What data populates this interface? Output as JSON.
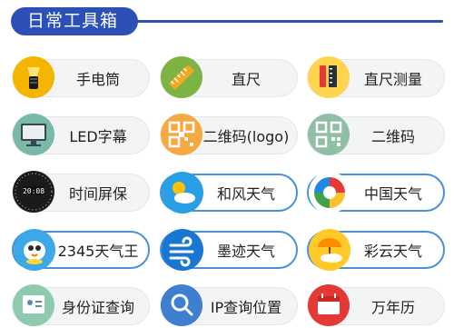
{
  "section": {
    "title": "日常工具箱",
    "accent": "#2c4fb8"
  },
  "tools": [
    {
      "label": "手电筒",
      "icon": "flashlight-icon"
    },
    {
      "label": "直尺",
      "icon": "ruler-icon"
    },
    {
      "label": "直尺测量",
      "icon": "ruler-measure-icon"
    },
    {
      "label": "LED字幕",
      "icon": "monitor-icon"
    },
    {
      "label": "二维码(logo)",
      "icon": "qr-logo-icon"
    },
    {
      "label": "二维码",
      "icon": "qr-code-icon"
    },
    {
      "label": "时间屏保",
      "icon": "digital-clock-icon"
    },
    {
      "label": "和风天气",
      "icon": "sun-cloud-icon"
    },
    {
      "label": "中国天气",
      "icon": "colorful-swirl-icon"
    },
    {
      "label": "2345天气王",
      "icon": "bird-mascot-icon"
    },
    {
      "label": "墨迹天气",
      "icon": "wind-icon"
    },
    {
      "label": "彩云天气",
      "icon": "umbrella-cloud-icon"
    },
    {
      "label": "身份证查询",
      "icon": "id-card-icon"
    },
    {
      "label": "IP查询位置",
      "icon": "magnifier-icon"
    },
    {
      "label": "万年历",
      "icon": "calendar-icon"
    }
  ]
}
